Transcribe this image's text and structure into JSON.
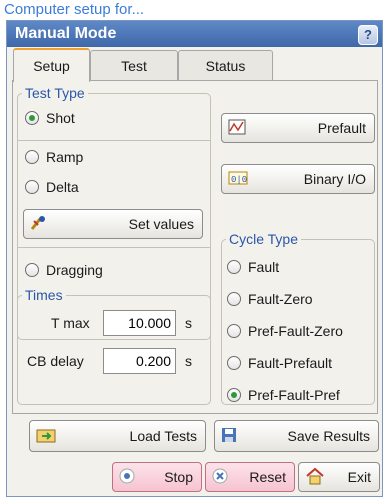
{
  "page_header": "Computer setup for...",
  "window": {
    "title": "Manual Mode",
    "help": "?"
  },
  "tabs": [
    "Setup",
    "Test",
    "Status"
  ],
  "test_type": {
    "legend": "Test Type",
    "options": [
      "Shot",
      "Ramp",
      "Delta",
      "Dragging"
    ],
    "selected": "Shot",
    "set_values_label": "Set values"
  },
  "buttons": {
    "prefault": "Prefault",
    "binary_io": "Binary I/O",
    "load_tests": "Load Tests",
    "save_results": "Save Results",
    "stop": "Stop",
    "reset": "Reset",
    "exit": "Exit"
  },
  "cycle_type": {
    "legend": "Cycle Type",
    "options": [
      "Fault",
      "Fault-Zero",
      "Pref-Fault-Zero",
      "Fault-Prefault",
      "Pref-Fault-Pref"
    ],
    "selected": "Pref-Fault-Pref"
  },
  "times": {
    "legend": "Times",
    "t_max_label": "T max",
    "t_max_value": "10.000",
    "t_max_unit": "s",
    "cb_delay_label": "CB delay",
    "cb_delay_value": "0.200",
    "cb_delay_unit": "s"
  },
  "colors": {
    "title_bar": "#4a74b8",
    "accent_radio": "#2f9a3a",
    "legend_text": "#2b57a8"
  }
}
